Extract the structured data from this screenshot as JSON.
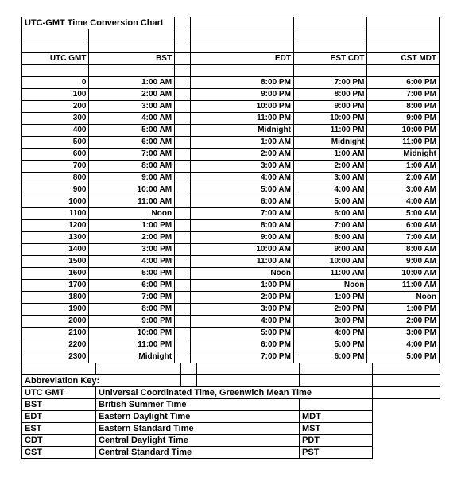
{
  "document": {
    "title": "UTC-GMT Time Conversion Chart"
  },
  "colors": {
    "header_accent": "#00ccff",
    "utc_accent": "#ff0000",
    "text": "#000000",
    "grid": "#000000",
    "background": "#ffffff"
  },
  "table": {
    "headers": {
      "col1": "UTC GMT",
      "col2": "BST",
      "col3": "",
      "col4": "EDT",
      "col5": "EST CDT",
      "col6": "CST MDT"
    },
    "rows": [
      {
        "utc": "0",
        "bst": "1:00 AM",
        "edt": "8:00 PM",
        "est_cdt": "7:00 PM",
        "cst_mdt": "6:00 PM"
      },
      {
        "utc": "100",
        "bst": "2:00 AM",
        "edt": "9:00 PM",
        "est_cdt": "8:00 PM",
        "cst_mdt": "7:00 PM"
      },
      {
        "utc": "200",
        "bst": "3:00 AM",
        "edt": "10:00 PM",
        "est_cdt": "9:00 PM",
        "cst_mdt": "8:00 PM"
      },
      {
        "utc": "300",
        "bst": "4:00 AM",
        "edt": "11:00 PM",
        "est_cdt": "10:00 PM",
        "cst_mdt": "9:00 PM"
      },
      {
        "utc": "400",
        "bst": "5:00 AM",
        "edt": "Midnight",
        "est_cdt": "11:00 PM",
        "cst_mdt": "10:00 PM"
      },
      {
        "utc": "500",
        "bst": "6:00 AM",
        "edt": "1:00 AM",
        "est_cdt": "Midnight",
        "cst_mdt": "11:00 PM"
      },
      {
        "utc": "600",
        "bst": "7:00 AM",
        "edt": "2:00 AM",
        "est_cdt": "1:00 AM",
        "cst_mdt": "Midnight"
      },
      {
        "utc": "700",
        "bst": "8:00 AM",
        "edt": "3:00 AM",
        "est_cdt": "2:00 AM",
        "cst_mdt": "1:00 AM"
      },
      {
        "utc": "800",
        "bst": "9:00 AM",
        "edt": "4:00 AM",
        "est_cdt": "3:00 AM",
        "cst_mdt": "2:00 AM"
      },
      {
        "utc": "900",
        "bst": "10:00 AM",
        "edt": "5:00 AM",
        "est_cdt": "4:00 AM",
        "cst_mdt": "3:00 AM"
      },
      {
        "utc": "1000",
        "bst": "11:00 AM",
        "edt": "6:00 AM",
        "est_cdt": "5:00 AM",
        "cst_mdt": "4:00 AM"
      },
      {
        "utc": "1100",
        "bst": "Noon",
        "edt": "7:00 AM",
        "est_cdt": "6:00 AM",
        "cst_mdt": "5:00 AM"
      },
      {
        "utc": "1200",
        "bst": "1:00 PM",
        "edt": "8:00 AM",
        "est_cdt": "7:00 AM",
        "cst_mdt": "6:00 AM"
      },
      {
        "utc": "1300",
        "bst": "2:00 PM",
        "edt": "9:00 AM",
        "est_cdt": "8:00 AM",
        "cst_mdt": "7:00 AM"
      },
      {
        "utc": "1400",
        "bst": "3:00 PM",
        "edt": "10:00 AM",
        "est_cdt": "9:00 AM",
        "cst_mdt": "8:00 AM"
      },
      {
        "utc": "1500",
        "bst": "4:00 PM",
        "edt": "11:00 AM",
        "est_cdt": "10:00 AM",
        "cst_mdt": "9:00 AM"
      },
      {
        "utc": "1600",
        "bst": "5:00 PM",
        "edt": "Noon",
        "est_cdt": "11:00 AM",
        "cst_mdt": "10:00 AM"
      },
      {
        "utc": "1700",
        "bst": "6:00 PM",
        "edt": "1:00 PM",
        "est_cdt": "Noon",
        "cst_mdt": "11:00 AM"
      },
      {
        "utc": "1800",
        "bst": "7:00 PM",
        "edt": "2:00 PM",
        "est_cdt": "1:00 PM",
        "cst_mdt": "Noon"
      },
      {
        "utc": "1900",
        "bst": "8:00 PM",
        "edt": "3:00 PM",
        "est_cdt": "2:00 PM",
        "cst_mdt": "1:00 PM"
      },
      {
        "utc": "2000",
        "bst": "9:00 PM",
        "edt": "4:00 PM",
        "est_cdt": "3:00 PM",
        "cst_mdt": "2:00 PM"
      },
      {
        "utc": "2100",
        "bst": "10:00 PM",
        "edt": "5:00 PM",
        "est_cdt": "4:00 PM",
        "cst_mdt": "3:00 PM"
      },
      {
        "utc": "2200",
        "bst": "11:00 PM",
        "edt": "6:00 PM",
        "est_cdt": "5:00 PM",
        "cst_mdt": "4:00 PM"
      },
      {
        "utc": "2300",
        "bst": "Midnight",
        "edt": "7:00 PM",
        "est_cdt": "6:00 PM",
        "cst_mdt": "5:00 PM"
      }
    ]
  },
  "legend": {
    "heading": "Abbreviation Key:",
    "entries": [
      {
        "abbr": "UTC GMT",
        "meaning": "Universal Coordinated Time, Greenwich Mean Time",
        "alt": ""
      },
      {
        "abbr": "BST",
        "meaning": "British Summer Time",
        "alt": ""
      },
      {
        "abbr": "EDT",
        "meaning": "Eastern Daylight Time",
        "alt": "MDT"
      },
      {
        "abbr": "EST",
        "meaning": "Eastern Standard Time",
        "alt": "MST"
      },
      {
        "abbr": "CDT",
        "meaning": "Central Daylight Time",
        "alt": "PDT"
      },
      {
        "abbr": "CST",
        "meaning": "Central Standard Time",
        "alt": "PST"
      }
    ]
  }
}
